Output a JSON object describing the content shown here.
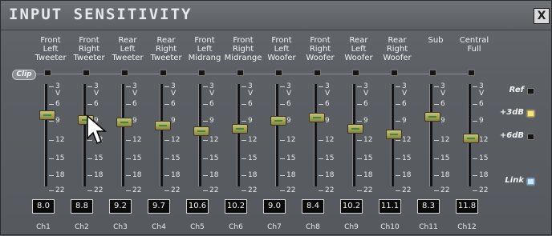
{
  "window": {
    "title": "INPUT SENSITIVITY",
    "close_label": "X"
  },
  "clip_label": "Clip",
  "scale_labels": [
    "3 V",
    "6",
    "9",
    "12",
    "15",
    "18",
    "22"
  ],
  "channels": [
    {
      "label": "Front\nLeft\nTweeter",
      "value": "8.0",
      "name": "Ch1"
    },
    {
      "label": "Front\nRight\nTweeter",
      "value": "8.8",
      "name": "Ch2"
    },
    {
      "label": "Rear\nLeft\nTweeter",
      "value": "9.2",
      "name": "Ch3"
    },
    {
      "label": "Rear\nRight\nTweeter",
      "value": "9.7",
      "name": "Ch4"
    },
    {
      "label": "Front\nLeft\nMidrang",
      "value": "10.6",
      "name": "Ch5"
    },
    {
      "label": "Front\nRight\nMidrange",
      "value": "10.2",
      "name": "Ch6"
    },
    {
      "label": "Front\nLeft\nWoofer",
      "value": "9.0",
      "name": "Ch7"
    },
    {
      "label": "Front\nRight\nWoofer",
      "value": "8.4",
      "name": "Ch8"
    },
    {
      "label": "Rear\nLeft\nWoofer",
      "value": "10.2",
      "name": "Ch9"
    },
    {
      "label": "Rear\nRight\nWoofer",
      "value": "11.1",
      "name": "Ch10"
    },
    {
      "label": "Sub",
      "value": "8.3",
      "name": "Ch11"
    },
    {
      "label": "Central\nFull",
      "value": "11.8",
      "name": "Ch12"
    }
  ],
  "side": {
    "ref": {
      "label": "Ref",
      "state": "off"
    },
    "plus3db": {
      "label": "+3dB",
      "state": "on"
    },
    "plus6db": {
      "label": "+6dB",
      "state": "off"
    },
    "link": {
      "label": "Link",
      "state": "on"
    }
  },
  "colors": {
    "led_on_yellow": "#f2e48a",
    "led_on_blue": "#cfe6ff",
    "panel": "#5b5f64"
  }
}
